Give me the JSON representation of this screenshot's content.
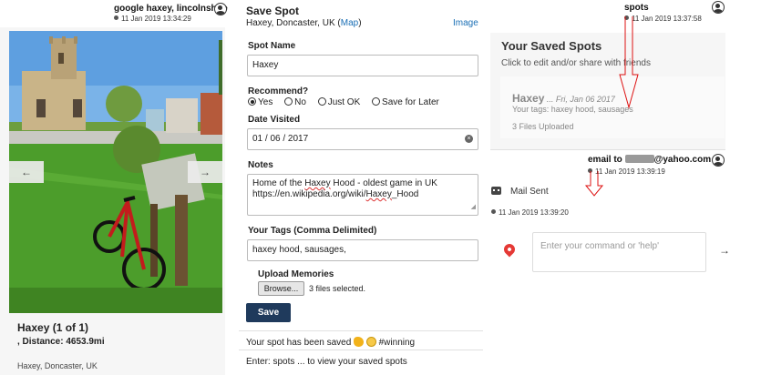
{
  "left_message": {
    "text": "google haxey, lincolnshire",
    "time": "11 Jan 2019 13:34:29"
  },
  "spot_card": {
    "title": "Haxey (1 of 1)",
    "distance": ", Distance: 4653.9mi",
    "location": "Haxey, Doncaster, UK",
    "prev_icon": "arrow-left",
    "next_icon": "arrow-right"
  },
  "form": {
    "title": "Save Spot",
    "location_prefix": "Haxey, Doncaster, UK (",
    "map_link": "Map",
    "location_suffix": ")",
    "image_link": "Image",
    "spot_name_label": "Spot Name",
    "spot_name_value": "Haxey",
    "recommend_label": "Recommend?",
    "recommend_options": [
      "Yes",
      "No",
      "Just OK",
      "Save for Later"
    ],
    "recommend_selected": "Yes",
    "date_label": "Date Visited",
    "date_value": "01 / 06 / 2017",
    "notes_label": "Notes",
    "notes_line1_a": "Home of the ",
    "notes_line1_b": "Haxey",
    "notes_line1_c": " Hood - oldest game in UK",
    "notes_line2_a": "https://en.wikipedia.org/wiki/",
    "notes_line2_b": "Haxey",
    "notes_line2_c": "_Hood",
    "tags_label": "Your Tags (Comma Delimited)",
    "tags_value": "haxey hood, sausages,",
    "upload_label": "Upload Memories",
    "browse_label": "Browse...",
    "files_selected": "3 files selected.",
    "save_label": "Save"
  },
  "chat": {
    "saved_message_prefix": "Your spot has been saved ",
    "saved_message_suffix": " #winning",
    "hint": "Enter: spots ... to view your saved spots"
  },
  "right": {
    "spots_message": {
      "text": "spots",
      "time": "11 Jan 2019 13:37:58"
    },
    "saved_spots": {
      "title": "Your Saved Spots",
      "subtitle": "Click to edit and/or share with friends",
      "items": [
        {
          "name": "Haxey",
          "date": " ... Fri, Jan 06 2017",
          "tags": "Your tags: haxey hood, sausages",
          "files": "3 Files Uploaded"
        }
      ]
    },
    "email_message": {
      "prefix": "email to ",
      "suffix": "@yahoo.com",
      "time": "11 Jan 2019 13:39:19"
    },
    "mail_sent": {
      "text": "Mail Sent",
      "time": "11 Jan 2019 13:39:20"
    },
    "command_placeholder": "Enter your command or 'help'",
    "accent_red": "#e53935",
    "save_button_color": "#1f3a5c",
    "link_color": "#1a6fb5"
  }
}
